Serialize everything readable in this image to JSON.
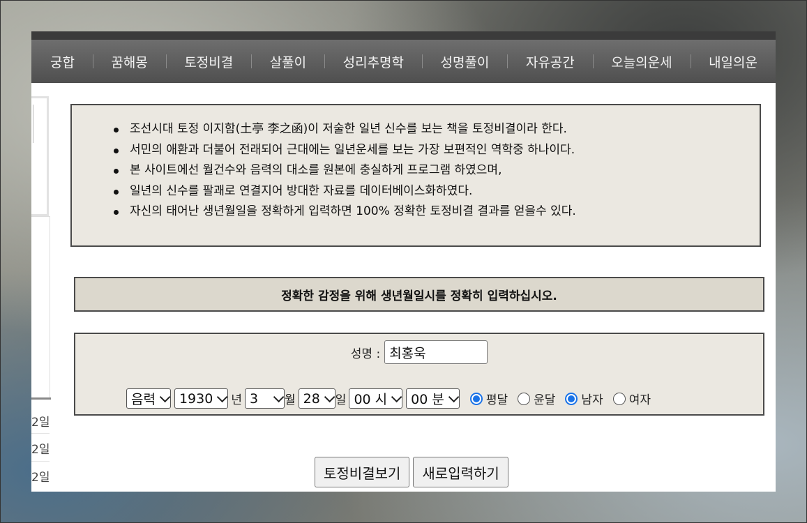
{
  "nav": {
    "items": [
      "궁합",
      "꿈해몽",
      "토정비결",
      "살풀이",
      "성리추명학",
      "성명풀이",
      "자유공간",
      "오늘의운세",
      "내일의운"
    ]
  },
  "sidebar": {
    "dates": [
      "2일",
      "2일",
      "2일"
    ]
  },
  "intro": {
    "lines": [
      "조선시대 토정 이지함(土亭 李之函)이 저술한 일년 신수를 보는 책을 토정비결이라 한다.",
      "서민의 애환과 더불어 전래되어 근대에는 일년운세를 보는 가장 보편적인 역학중 하나이다.",
      "본 사이트에선 월건수와 음력의 대소를 원본에 충실하게 프로그램 하였으며,",
      "일년의 신수를 팔괘로 연결지어 방대한 자료를 데이터베이스화하였다.",
      "자신의 태어난 생년월일을 정확하게 입력하면 100% 정확한 토정비결 결과를 얻을수 있다."
    ]
  },
  "notice": {
    "text": "정확한 감정을 위해 생년월일시를 정확히 입력하십시오."
  },
  "form": {
    "name_label": "성명 :",
    "name_value": "최홍욱",
    "calendar": "음력",
    "year": "1930",
    "year_unit": "년",
    "month": "3",
    "month_unit": "월",
    "day": "28",
    "day_unit": "일",
    "hour": "00 시",
    "minute": "00 분",
    "leap_normal_label": "평달",
    "leap_label": "윤달",
    "male_label": "남자",
    "female_label": "여자",
    "leap_selected": "평달",
    "gender_selected": "남자"
  },
  "buttons": {
    "submit": "토정비결보기",
    "reset": "새로입력하기"
  },
  "colors": {
    "accent": "#1a73e8",
    "nav_bg": "#5a5a5a",
    "panel_bg": "#ebe8e1",
    "notice_bg": "#dcd8cd"
  }
}
